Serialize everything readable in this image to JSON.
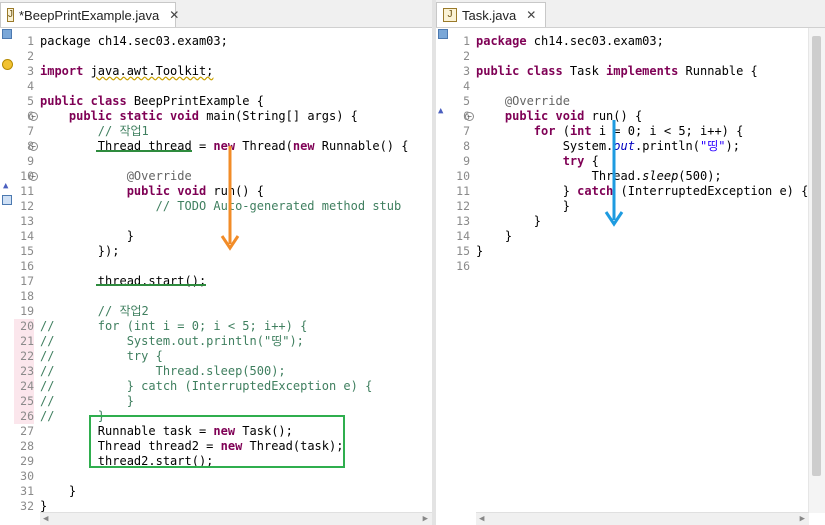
{
  "left_editor": {
    "tab_label": "*BeepPrintExample.java",
    "tab_icon": "java-file-icon",
    "lines": [
      {
        "n": "1",
        "t": [
          [
            "package ch14.sec03.exam03;",
            ""
          ]
        ]
      },
      {
        "n": "2",
        "t": []
      },
      {
        "n": "3",
        "t": [
          [
            "import ",
            "kw"
          ],
          [
            "java.awt.Toolkit;",
            "warn"
          ]
        ]
      },
      {
        "n": "4",
        "t": []
      },
      {
        "n": "5",
        "t": [
          [
            "public class ",
            "kw"
          ],
          [
            "BeepPrintExample {",
            ""
          ]
        ]
      },
      {
        "n": "6",
        "t": [
          [
            "    ",
            ""
          ],
          [
            "public static void ",
            "kw"
          ],
          [
            "main(String[] args) {",
            ""
          ]
        ]
      },
      {
        "n": "7",
        "t": [
          [
            "        // 작업1",
            "cm"
          ]
        ]
      },
      {
        "n": "8",
        "t": [
          [
            "        Thread thread = ",
            ""
          ],
          [
            "new ",
            "kw"
          ],
          [
            "Thread(",
            ""
          ],
          [
            "new ",
            "kw"
          ],
          [
            "Runnable() {",
            ""
          ]
        ]
      },
      {
        "n": "9",
        "t": []
      },
      {
        "n": "10",
        "t": [
          [
            "            @Override",
            "ann"
          ]
        ]
      },
      {
        "n": "11",
        "t": [
          [
            "            ",
            ""
          ],
          [
            "public void ",
            "kw"
          ],
          [
            "run() {",
            ""
          ]
        ]
      },
      {
        "n": "12",
        "t": [
          [
            "                // TODO Auto-generated method stub",
            "cm"
          ]
        ]
      },
      {
        "n": "13",
        "t": []
      },
      {
        "n": "14",
        "t": [
          [
            "            }",
            ""
          ]
        ]
      },
      {
        "n": "15",
        "t": [
          [
            "        });",
            ""
          ]
        ]
      },
      {
        "n": "16",
        "t": []
      },
      {
        "n": "17",
        "t": [
          [
            "        thread.start();",
            ""
          ]
        ]
      },
      {
        "n": "18",
        "t": []
      },
      {
        "n": "19",
        "t": [
          [
            "        // 작업2",
            "cm"
          ]
        ]
      },
      {
        "n": "20",
        "t": [
          [
            "//      for (int i = 0; i < 5; i++) {",
            "cm"
          ]
        ]
      },
      {
        "n": "21",
        "t": [
          [
            "//          System.out.println(\"띵\");",
            "cm"
          ]
        ]
      },
      {
        "n": "22",
        "t": [
          [
            "//          try {",
            "cm"
          ]
        ]
      },
      {
        "n": "23",
        "t": [
          [
            "//              Thread.sleep(500);",
            "cm"
          ]
        ]
      },
      {
        "n": "24",
        "t": [
          [
            "//          } catch (InterruptedException e) {",
            "cm"
          ]
        ]
      },
      {
        "n": "25",
        "t": [
          [
            "//          }",
            "cm"
          ]
        ]
      },
      {
        "n": "26",
        "t": [
          [
            "//      }",
            "cm"
          ]
        ]
      },
      {
        "n": "27",
        "t": [
          [
            "        Runnable task = ",
            ""
          ],
          [
            "new ",
            "kw"
          ],
          [
            "Task();",
            ""
          ]
        ]
      },
      {
        "n": "28",
        "t": [
          [
            "        Thread thread2 = ",
            ""
          ],
          [
            "new ",
            "kw"
          ],
          [
            "Thread(task);",
            ""
          ]
        ]
      },
      {
        "n": "29",
        "t": [
          [
            "        thread2.start();",
            ""
          ]
        ]
      },
      {
        "n": "30",
        "t": []
      },
      {
        "n": "31",
        "t": [
          [
            "    }",
            ""
          ]
        ]
      },
      {
        "n": "32",
        "t": [
          [
            "}",
            ""
          ]
        ]
      }
    ]
  },
  "right_editor": {
    "tab_label": "Task.java",
    "tab_icon": "java-file-icon",
    "lines": [
      {
        "n": "1",
        "t": [
          [
            "package ",
            "kw"
          ],
          [
            "ch14.sec03.exam03;",
            ""
          ]
        ]
      },
      {
        "n": "2",
        "t": []
      },
      {
        "n": "3",
        "t": [
          [
            "public class ",
            "kw"
          ],
          [
            "Task ",
            ""
          ],
          [
            "implements ",
            "kw"
          ],
          [
            "Runnable {",
            ""
          ]
        ]
      },
      {
        "n": "4",
        "t": []
      },
      {
        "n": "5",
        "t": [
          [
            "    @Override",
            "ann"
          ]
        ]
      },
      {
        "n": "6",
        "t": [
          [
            "    ",
            ""
          ],
          [
            "public void ",
            "kw"
          ],
          [
            "run() {",
            ""
          ]
        ]
      },
      {
        "n": "7",
        "t": [
          [
            "        ",
            ""
          ],
          [
            "for ",
            "kw"
          ],
          [
            "(",
            ""
          ],
          [
            "int ",
            "kw"
          ],
          [
            "i = 0; i < 5; i++) {",
            ""
          ]
        ]
      },
      {
        "n": "8",
        "t": [
          [
            "            System.",
            ""
          ],
          [
            "out",
            "fld"
          ],
          [
            ".println(",
            ""
          ],
          [
            "\"띵\"",
            "str"
          ],
          [
            ");",
            ""
          ]
        ]
      },
      {
        "n": "9",
        "t": [
          [
            "            ",
            ""
          ],
          [
            "try ",
            "kw"
          ],
          [
            "{",
            ""
          ]
        ]
      },
      {
        "n": "10",
        "t": [
          [
            "                Thread.",
            ""
          ],
          [
            "sleep",
            "it"
          ],
          [
            "(500);",
            ""
          ]
        ]
      },
      {
        "n": "11",
        "t": [
          [
            "            } ",
            ""
          ],
          [
            "catch ",
            "kw"
          ],
          [
            "(InterruptedException e) {",
            ""
          ]
        ]
      },
      {
        "n": "12",
        "t": [
          [
            "            }",
            ""
          ]
        ]
      },
      {
        "n": "13",
        "t": [
          [
            "        }",
            ""
          ]
        ]
      },
      {
        "n": "14",
        "t": [
          [
            "    }",
            ""
          ]
        ]
      },
      {
        "n": "15",
        "t": [
          [
            "}",
            ""
          ]
        ]
      },
      {
        "n": "16",
        "t": []
      }
    ]
  },
  "colors": {
    "keyword": "#7f0055",
    "comment": "#3f7f5f",
    "annotation": "#646464",
    "string": "#2a00ff",
    "field": "#0000c0",
    "orange_arrow": "#f28c28",
    "blue_arrow": "#1e9be0",
    "green_mark": "#2fae4e"
  }
}
